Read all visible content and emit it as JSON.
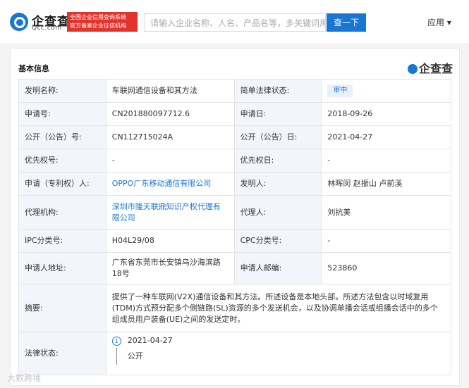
{
  "header": {
    "logo_text": "企查查",
    "logo_sub": "Qcc.com",
    "badge_line1": "全国企业信用查询系统",
    "badge_line2": "官方备案企业征信机构",
    "search_placeholder": "请输入企业名称、人名、产品名等，多关键词用空",
    "search_button": "查一下",
    "app_menu": "应用 ▾"
  },
  "section": {
    "title": "基本信息",
    "brand": "企查查"
  },
  "rows": {
    "r1": {
      "l1": "发明名称:",
      "v1": "车联网通信设备和其方法",
      "l2": "简单法律状态:",
      "v2": "审中"
    },
    "r2": {
      "l1": "申请号:",
      "v1": "CN201880097712.6",
      "l2": "申请日:",
      "v2": "2018-09-26"
    },
    "r3": {
      "l1": "公开（公告）号:",
      "v1": "CN112715024A",
      "l2": "公开（公告）日:",
      "v2": "2021-04-27"
    },
    "r4": {
      "l1": "优先权号:",
      "v1": "-",
      "l2": "优先权日:",
      "v2": "-"
    },
    "r5": {
      "l1": "申请（专利权）人:",
      "v1": "OPPO广东移动通信有限公司",
      "l2": "发明人:",
      "v2": "林晖闵 赵振山 卢前溪"
    },
    "r6": {
      "l1": "代理机构:",
      "v1": "深圳市隆天联鼎知识产权代理有限公司",
      "l2": "代理人:",
      "v2": "刘抗美"
    },
    "r7": {
      "l1": "IPC分类号:",
      "v1": "H04L29/08",
      "l2": "CPC分类号:",
      "v2": "-"
    },
    "r8": {
      "l1": "申请人地址:",
      "v1": "广东省东莞市长安镇乌沙海滨路18号",
      "l2": "申请人邮编:",
      "v2": "523860"
    },
    "r9": {
      "l1": "摘要:",
      "v1": "提供了一种车联网(V2X)通信设备和其方法。所述设备是本地头部。所述方法包含以时域复用(TDM)方式预分配多个侧链路(SL)资源的多个发送机会，以及协调单播会话或组播会话中的多个组成员用户装备(UE)之间的发送定时。"
    },
    "r10": {
      "l1": "法律状态:",
      "step_no": "1",
      "date": "2021-04-27",
      "desc": "公开"
    }
  },
  "watermark": "大数跨境",
  "colors": {
    "primary": "#1976d2",
    "badge_red": "#e2332d",
    "label_bg": "#f2f6fb"
  }
}
